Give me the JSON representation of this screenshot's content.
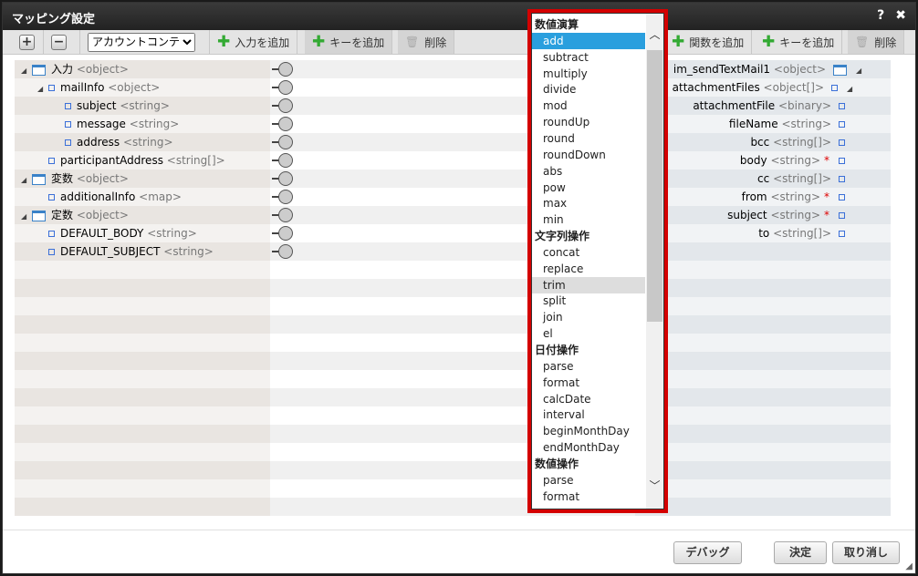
{
  "window": {
    "title": "マッピング設定",
    "help": "?",
    "close": "✖"
  },
  "toolbar_left": {
    "expand": "+",
    "collapse": "−",
    "select_value": "アカウントコンテ",
    "add_input": "入力を追加",
    "add_key": "キーを追加",
    "delete": "削除"
  },
  "toolbar_right": {
    "add_function": "関数を追加",
    "add_key": "キーを追加",
    "delete": "削除"
  },
  "left_tree": [
    {
      "name": "入力",
      "type": "<object>",
      "level": 0,
      "toggle": true,
      "icon": "window"
    },
    {
      "name": "mailInfo",
      "type": "<object>",
      "level": 1,
      "toggle": true,
      "icon": "square"
    },
    {
      "name": "subject",
      "type": "<string>",
      "level": 2,
      "toggle": false,
      "icon": "square"
    },
    {
      "name": "message",
      "type": "<string>",
      "level": 2,
      "toggle": false,
      "icon": "square"
    },
    {
      "name": "address",
      "type": "<string>",
      "level": 2,
      "toggle": false,
      "icon": "square"
    },
    {
      "name": "participantAddress",
      "type": "<string[]>",
      "level": 1,
      "toggle": false,
      "icon": "square"
    },
    {
      "name": "変数",
      "type": "<object>",
      "level": 0,
      "toggle": true,
      "icon": "window"
    },
    {
      "name": "additionalInfo",
      "type": "<map>",
      "level": 1,
      "toggle": false,
      "icon": "square"
    },
    {
      "name": "定数",
      "type": "<object>",
      "level": 0,
      "toggle": true,
      "icon": "window"
    },
    {
      "name": "DEFAULT_BODY",
      "type": "<string>",
      "level": 1,
      "toggle": false,
      "icon": "square"
    },
    {
      "name": "DEFAULT_SUBJECT",
      "type": "<string>",
      "level": 1,
      "toggle": false,
      "icon": "square"
    }
  ],
  "right_tree": [
    {
      "name": "im_sendTextMail1",
      "type": "<object>",
      "required": false,
      "icon": "window",
      "toggle": true
    },
    {
      "name": "attachmentFiles",
      "type": "<object[]>",
      "required": false,
      "icon": "square",
      "toggle": true
    },
    {
      "name": "attachmentFile",
      "type": "<binary>",
      "required": false,
      "icon": "square",
      "toggle": false
    },
    {
      "name": "fileName",
      "type": "<string>",
      "required": false,
      "icon": "square",
      "toggle": false
    },
    {
      "name": "bcc",
      "type": "<string[]>",
      "required": false,
      "icon": "square",
      "toggle": false
    },
    {
      "name": "body",
      "type": "<string>",
      "required": true,
      "icon": "square",
      "toggle": false
    },
    {
      "name": "cc",
      "type": "<string[]>",
      "required": false,
      "icon": "square",
      "toggle": false
    },
    {
      "name": "from",
      "type": "<string>",
      "required": true,
      "icon": "square",
      "toggle": false
    },
    {
      "name": "subject",
      "type": "<string>",
      "required": true,
      "icon": "square",
      "toggle": false
    },
    {
      "name": "to",
      "type": "<string[]>",
      "required": false,
      "icon": "square",
      "toggle": false
    }
  ],
  "required_mark": "*",
  "function_list": [
    {
      "label": "数値演算",
      "header": true
    },
    {
      "label": "add",
      "state": "selected"
    },
    {
      "label": "subtract"
    },
    {
      "label": "multiply"
    },
    {
      "label": "divide"
    },
    {
      "label": "mod"
    },
    {
      "label": "roundUp"
    },
    {
      "label": "round"
    },
    {
      "label": "roundDown"
    },
    {
      "label": "abs"
    },
    {
      "label": "pow"
    },
    {
      "label": "max"
    },
    {
      "label": "min"
    },
    {
      "label": "文字列操作",
      "header": true
    },
    {
      "label": "concat"
    },
    {
      "label": "replace"
    },
    {
      "label": "trim",
      "state": "hover"
    },
    {
      "label": "split"
    },
    {
      "label": "join"
    },
    {
      "label": "el"
    },
    {
      "label": "日付操作",
      "header": true
    },
    {
      "label": "parse"
    },
    {
      "label": "format"
    },
    {
      "label": "calcDate"
    },
    {
      "label": "interval"
    },
    {
      "label": "beginMonthDay"
    },
    {
      "label": "endMonthDay"
    },
    {
      "label": "数値操作",
      "header": true
    },
    {
      "label": "parse"
    },
    {
      "label": "format"
    }
  ],
  "footer": {
    "debug": "デバッグ",
    "ok": "決定",
    "cancel": "取り消し"
  }
}
